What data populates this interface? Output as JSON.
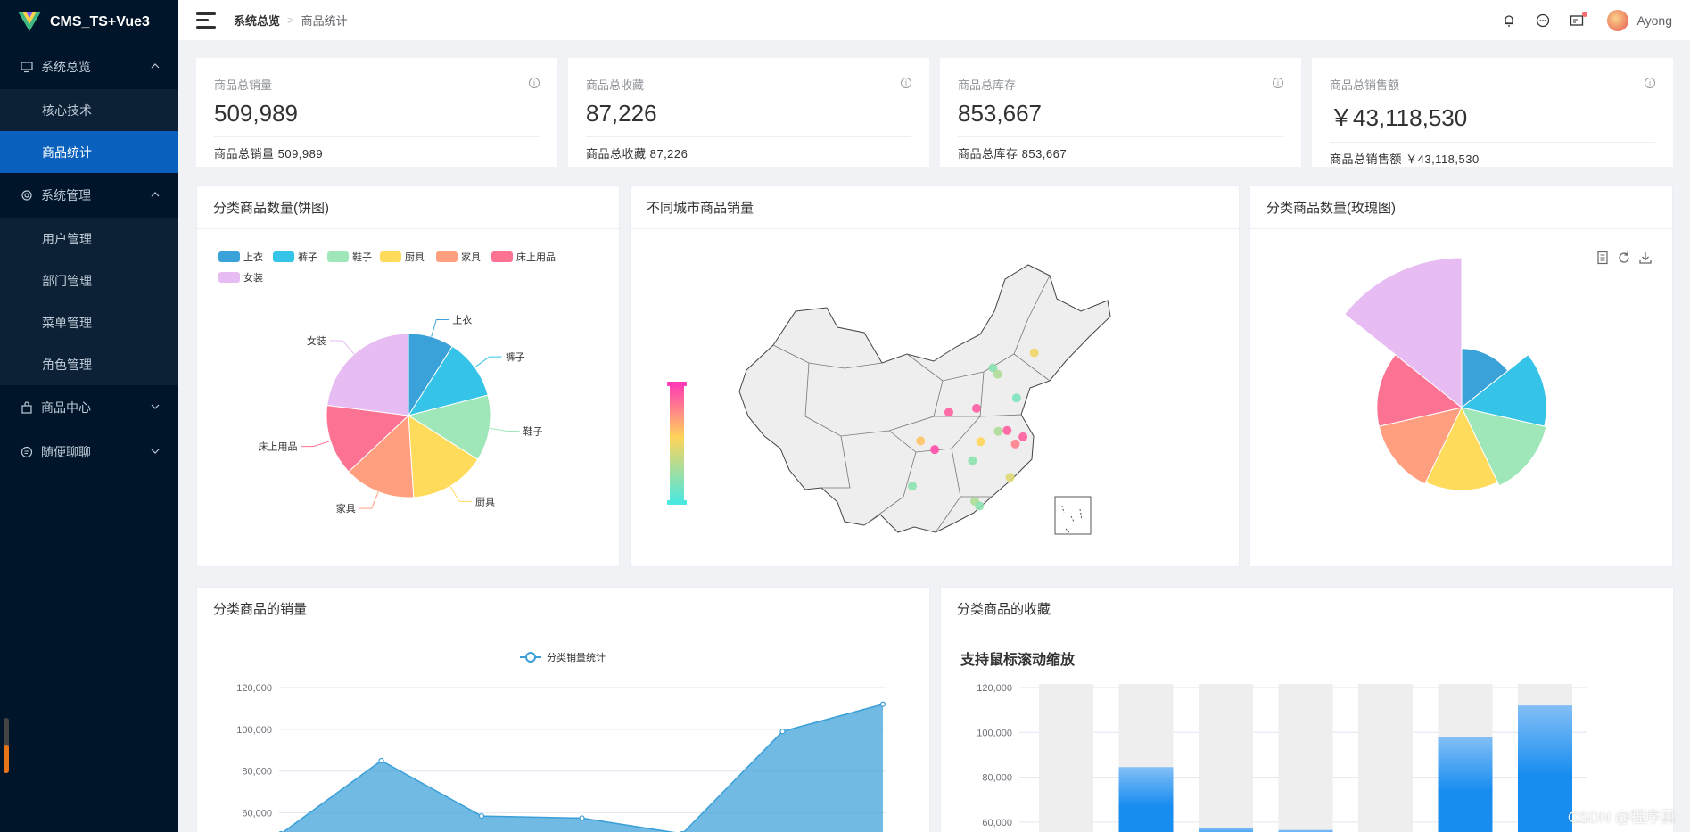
{
  "app": {
    "title": "CMS_TS+Vue3"
  },
  "sidebar": {
    "groups": [
      {
        "label": "系统总览",
        "items": [
          "核心技术",
          "商品统计"
        ]
      },
      {
        "label": "系统管理",
        "items": [
          "用户管理",
          "部门管理",
          "菜单管理",
          "角色管理"
        ]
      },
      {
        "label": "商品中心",
        "items": []
      },
      {
        "label": "随便聊聊",
        "items": []
      }
    ],
    "active_item": "商品统计"
  },
  "header": {
    "breadcrumb": [
      "系统总览",
      "商品统计"
    ],
    "user_name": "Ayong"
  },
  "stats": [
    {
      "title": "商品总销量",
      "value": "509,989",
      "footer": "商品总销量 509,989"
    },
    {
      "title": "商品总收藏",
      "value": "87,226",
      "footer": "商品总收藏 87,226"
    },
    {
      "title": "商品总库存",
      "value": "853,667",
      "footer": "商品总库存 853,667"
    },
    {
      "title": "商品总销售额",
      "value": "￥43,118,530",
      "footer": "商品总销售额 ￥43,118,530"
    }
  ],
  "panels": {
    "pie": "分类商品数量(饼图)",
    "map": "不同城市商品销量",
    "rose": "分类商品数量(玫瑰图)",
    "line": "分类商品的销量",
    "bar": "分类商品的收藏"
  },
  "colors": {
    "上衣": "#3ba1d9",
    "裤子": "#36c3e8",
    "鞋子": "#9fe6b8",
    "厨具": "#ffdb5c",
    "家具": "#ff9f7f",
    "床上用品": "#fb7293",
    "女装": "#e7bcf3",
    "sidebar_bg": "#001529",
    "active": "#0a60bd",
    "line": "#3a9fd8",
    "bar": "#3a9ff0"
  },
  "chart_data": [
    {
      "type": "pie",
      "title": "分类商品数量(饼图)",
      "legend_placement": "top-left",
      "slices": [
        {
          "name": "上衣",
          "value": 9
        },
        {
          "name": "裤子",
          "value": 12
        },
        {
          "name": "鞋子",
          "value": 13
        },
        {
          "name": "厨具",
          "value": 15
        },
        {
          "name": "家具",
          "value": 14
        },
        {
          "name": "床上用品",
          "value": 14
        },
        {
          "name": "女装",
          "value": 23
        }
      ]
    },
    {
      "type": "pie",
      "subtype": "rose",
      "title": "分类商品数量(玫瑰图)",
      "slices": [
        {
          "name": "上衣",
          "value": 45
        },
        {
          "name": "裤子",
          "value": 72
        },
        {
          "name": "鞋子",
          "value": 74
        },
        {
          "name": "厨具",
          "value": 70
        },
        {
          "name": "家具",
          "value": 72
        },
        {
          "name": "床上用品",
          "value": 72
        },
        {
          "name": "女装",
          "value": 140
        }
      ]
    },
    {
      "type": "area",
      "title": "分类商品的销量",
      "legend": [
        "分类销量统计"
      ],
      "series": [
        {
          "name": "分类销量统计",
          "values": [
            50000,
            85000,
            58500,
            57500,
            50000,
            99000,
            112000
          ]
        }
      ],
      "y_ticks": [
        "60,000",
        "80,000",
        "100,000",
        "120,000"
      ],
      "ylim": [
        50000,
        120000
      ]
    },
    {
      "type": "bar",
      "title": "分类商品的收藏",
      "subtitle": "支持鼠标滚动缩放",
      "values": [
        0,
        84500,
        57500,
        56500,
        0,
        98000,
        112000
      ],
      "y_ticks": [
        "60,000",
        "80,000",
        "100,000",
        "120,000"
      ],
      "ylim": [
        50000,
        120000
      ]
    },
    {
      "type": "map",
      "title": "不同城市商品销量",
      "points": [
        {
          "lon": 116.4,
          "lat": 39.9,
          "level": 0.2
        },
        {
          "lon": 117.2,
          "lat": 39.1,
          "level": 0.3
        },
        {
          "lon": 121.5,
          "lat": 31.2,
          "level": 0.9
        },
        {
          "lon": 120.2,
          "lat": 30.3,
          "level": 0.8
        },
        {
          "lon": 118.8,
          "lat": 32.0,
          "level": 0.9
        },
        {
          "lon": 113.3,
          "lat": 23.1,
          "level": 0.3
        },
        {
          "lon": 114.1,
          "lat": 22.5,
          "level": 0.2
        },
        {
          "lon": 104.1,
          "lat": 30.7,
          "level": 0.6
        },
        {
          "lon": 106.5,
          "lat": 29.6,
          "level": 0.95
        },
        {
          "lon": 108.9,
          "lat": 34.3,
          "level": 0.9
        },
        {
          "lon": 113.6,
          "lat": 34.8,
          "level": 0.9
        },
        {
          "lon": 112.9,
          "lat": 28.2,
          "level": 0.2
        },
        {
          "lon": 114.3,
          "lat": 30.6,
          "level": 0.55
        },
        {
          "lon": 120.4,
          "lat": 36.1,
          "level": 0.15
        },
        {
          "lon": 123.4,
          "lat": 41.8,
          "level": 0.5
        },
        {
          "lon": 102.7,
          "lat": 25.0,
          "level": 0.2
        },
        {
          "lon": 119.3,
          "lat": 26.1,
          "level": 0.45
        },
        {
          "lon": 117.3,
          "lat": 31.9,
          "level": 0.3
        }
      ]
    }
  ],
  "watermark": "CSDN @程序勇"
}
